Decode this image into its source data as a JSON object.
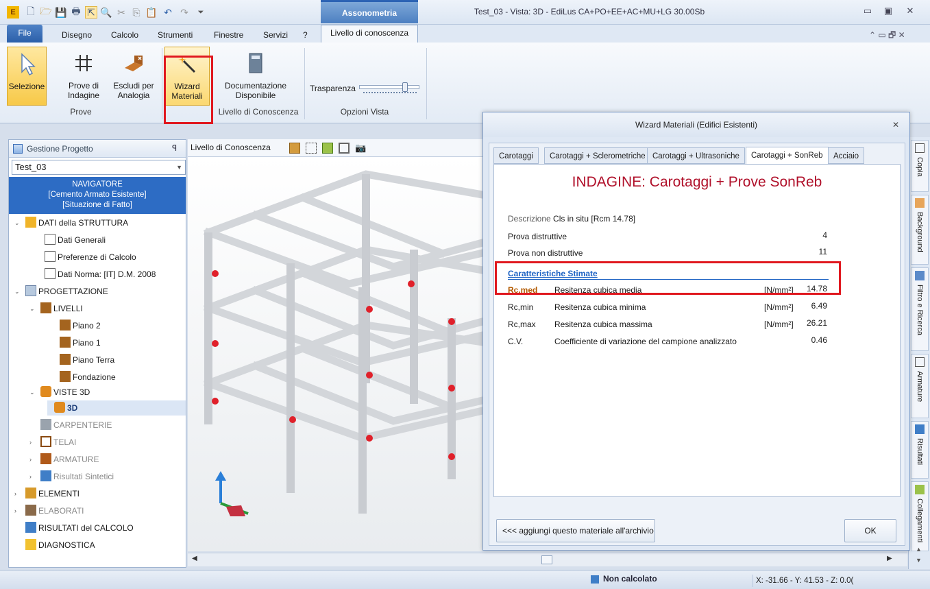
{
  "window": {
    "context_tab": "Assonometria",
    "title": "Test_03 - Vista: 3D - EdiLus CA+PO+EE+AC+MU+LG 30.00Sb"
  },
  "menu": {
    "file": "File",
    "tabs": [
      "Disegno",
      "Calcolo",
      "Strumenti",
      "Finestre",
      "Servizi",
      "?"
    ],
    "active_tab": "Livello di conoscenza"
  },
  "ribbon": {
    "selezione": "Selezione",
    "prove_indagine_1": "Prove di",
    "prove_indagine_2": "Indagine",
    "escludi_1": "Escludi per",
    "escludi_2": "Analogia",
    "wizard_1": "Wizard",
    "wizard_2": "Materiali",
    "doc_1": "Documentazione",
    "doc_2": "Disponibile",
    "trasparenza": "Trasparenza",
    "group_prove": "Prove",
    "group_livello": "Livello di Conoscenza",
    "group_opzioni": "Opzioni Vista"
  },
  "left_panel": {
    "header": "Gestione Progetto",
    "pin": "ꟼ",
    "combo_value": "Test_03",
    "banner_1": "NAVIGATORE",
    "banner_2": "[Cemento Armato Esistente]",
    "banner_3": "[Situazione di Fatto]",
    "tree": {
      "dati_struttura": "DATI della STRUTTURA",
      "dati_generali": "Dati Generali",
      "preferenze": "Preferenze di Calcolo",
      "dati_norma": "Dati Norma: [IT] D.M. 2008",
      "progettazione": "PROGETTAZIONE",
      "livelli": "LIVELLI",
      "piano2": "Piano 2",
      "piano1": "Piano 1",
      "piano_terra": "Piano Terra",
      "fondazione": "Fondazione",
      "viste3d": "VISTE 3D",
      "vista_3d": "3D",
      "carpenterie": "CARPENTERIE",
      "telai": "TELAI",
      "armature": "ARMATURE",
      "risultati_sintetici": "Risultati Sintetici",
      "elementi": "ELEMENTI",
      "elaborati": "ELABORATI",
      "risultati_calcolo": "RISULTATI del CALCOLO",
      "diagnostica": "DIAGNOSTICA"
    }
  },
  "viewport": {
    "combo": "Livello di Conoscenza"
  },
  "right_dock": [
    "Copia",
    "Background",
    "Filtro e Ricerca",
    "Armature",
    "Risultati",
    "Collegamenti"
  ],
  "dialog": {
    "title": "Wizard Materiali (Edifici Esistenti)",
    "tabs": [
      "Carotaggi",
      "Carotaggi + Sclerometriche",
      "Carotaggi + Ultrasoniche",
      "Carotaggi + SonReb",
      "Acciaio"
    ],
    "heading": "INDAGINE: Carotaggi + Prove SonReb",
    "descrizione_label": "Descrizione",
    "descrizione_value": "Cls in situ [Rcm 14.78]",
    "prova_distr_label": "Prova distruttive",
    "prova_distr_value": "4",
    "prova_nondistr_label": "Prova non distruttive",
    "prova_nondistr_value": "11",
    "section_title": "Caratteristiche Stimate",
    "rows": [
      {
        "sym": "Rc,med",
        "desc": "Resitenza cubica media",
        "unit": "[N/mm²]",
        "value": "14.78"
      },
      {
        "sym": "Rc,min",
        "desc": "Resitenza cubica minima",
        "unit": "[N/mm²]",
        "value": "6.49"
      },
      {
        "sym": "Rc,max",
        "desc": "Resitenza cubica massima",
        "unit": "[N/mm²]",
        "value": "26.21"
      },
      {
        "sym": "C.V.",
        "desc": "Coefficiente di variazione del campione analizzato",
        "unit": "",
        "value": "0.46"
      }
    ],
    "add_button": "<<< aggiungi questo materiale all'archivio",
    "ok_button": "OK"
  },
  "status": {
    "calc_state": "Non calcolato",
    "coordinates": "X: -31.66 - Y: 41.53 - Z: 0.0("
  },
  "colors": {
    "accent": "#2d6cc4",
    "highlight_red": "#e0181f",
    "heading_red": "#b0102a",
    "marker_red": "#e0202a"
  }
}
